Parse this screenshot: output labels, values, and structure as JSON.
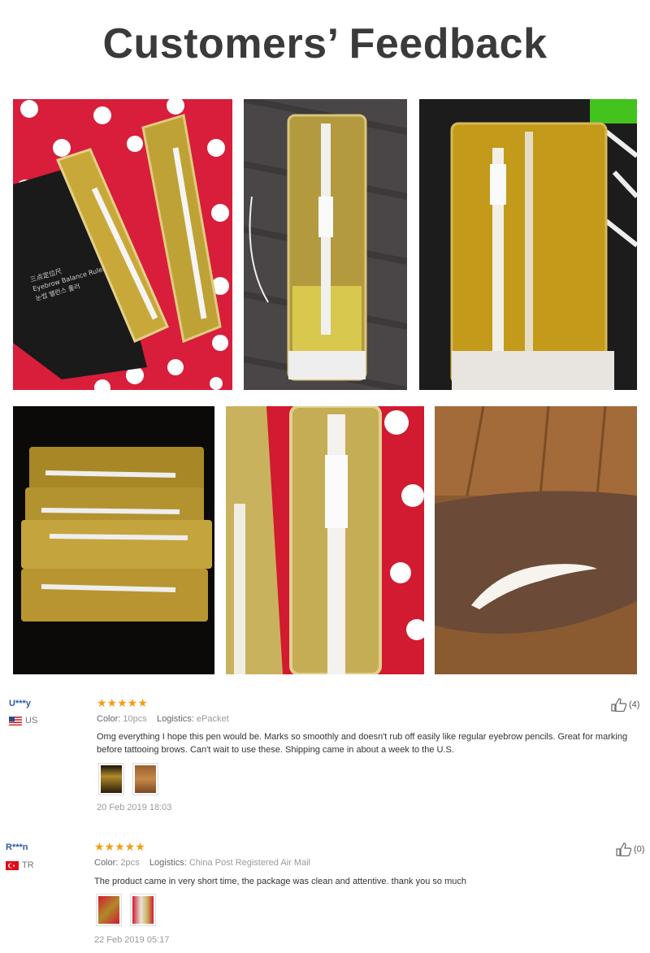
{
  "page": {
    "title": "Customers’ Feedback"
  },
  "photos": [
    {
      "name": "photo-pens-red-polka-dot-box",
      "alt": "Eyebrow Balance Ruler"
    },
    {
      "name": "photo-pen-dark-fabric"
    },
    {
      "name": "photo-pen-dark-background"
    },
    {
      "name": "photo-four-pens-gold-packs"
    },
    {
      "name": "photo-pen-gold-pack-red-dots"
    },
    {
      "name": "photo-eyebrow-drawn-on-arm"
    }
  ],
  "box_text": {
    "line1": "三点定位尺",
    "line2": "Eyebrow Balance Ruler",
    "line3": "눈썹 밸런스 룰러"
  },
  "reviews": [
    {
      "user": "U***y",
      "country": "US",
      "stars": "★★★★★",
      "color_label": "Color:",
      "color_value": "10pcs",
      "logistics_label": "Logistics:",
      "logistics_value": "ePacket",
      "text": "Omg everything I hope this pen would be. Marks so smoothly and doesn't rub off easily like regular eyebrow pencils. Great for marking before tattooing brows. Can't wait to use these. Shipping came in about a week to the U.S.",
      "date": "20 Feb 2019 18:03",
      "likes": "(4)"
    },
    {
      "user": "R***n",
      "country": "TR",
      "stars": "★★★★★",
      "color_label": "Color:",
      "color_value": "2pcs",
      "logistics_label": "Logistics:",
      "logistics_value": "China Post Registered Air Mail",
      "text": "The product came in very short time, the package was clean and attentive. thank you so much",
      "date": "22 Feb 2019 05:17",
      "likes": "(0)"
    }
  ],
  "colors": {
    "title": "#3a3a3a",
    "star": "#f39c12",
    "username": "#2c5aa0",
    "gold": "#c9a83a",
    "red_bg": "#d81e3a"
  }
}
